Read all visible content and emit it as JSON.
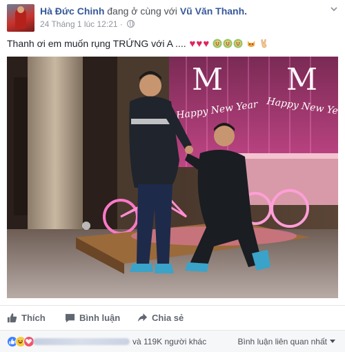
{
  "post": {
    "author": "Hà Đức Chinh",
    "with_text": "đang ở cùng với",
    "tagged": "Vũ Văn Thanh.",
    "timestamp": "24 Tháng 1 lúc 12:21 ·",
    "more_icon": "chevron-down-icon",
    "text": "Thanh ơi em muốn rụng TRỨNG với A ....",
    "emojis": [
      "heart",
      "heart",
      "heart",
      "smile-green",
      "smile-green",
      "smile-green",
      "cat-face",
      "victory-hand"
    ]
  },
  "photo": {
    "sign_text_left": "Happy New Year",
    "sign_text_right": "Happy New Year",
    "letter": "M"
  },
  "actions": {
    "like": "Thích",
    "comment": "Bình luận",
    "share": "Chia sẻ"
  },
  "reactions": {
    "icons": [
      "like",
      "haha",
      "love"
    ],
    "count_text": "và 119K người khác",
    "sort_label": "Bình luận liên quan nhất"
  },
  "colors": {
    "link": "#365899",
    "meta": "#90949c",
    "action": "#616770",
    "like_blue": "#4080ff",
    "love_red": "#f25268",
    "haha_yellow": "#f7c945",
    "neon_pink": "#ff6fc8"
  }
}
